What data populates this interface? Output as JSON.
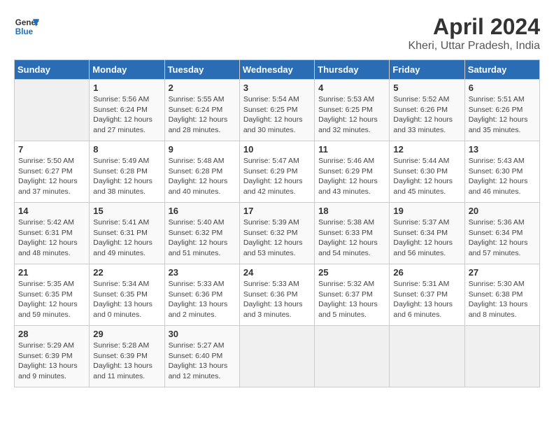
{
  "header": {
    "logo_line1": "General",
    "logo_line2": "Blue",
    "month": "April 2024",
    "location": "Kheri, Uttar Pradesh, India"
  },
  "weekdays": [
    "Sunday",
    "Monday",
    "Tuesday",
    "Wednesday",
    "Thursday",
    "Friday",
    "Saturday"
  ],
  "weeks": [
    [
      {
        "day": "",
        "info": ""
      },
      {
        "day": "1",
        "info": "Sunrise: 5:56 AM\nSunset: 6:24 PM\nDaylight: 12 hours\nand 27 minutes."
      },
      {
        "day": "2",
        "info": "Sunrise: 5:55 AM\nSunset: 6:24 PM\nDaylight: 12 hours\nand 28 minutes."
      },
      {
        "day": "3",
        "info": "Sunrise: 5:54 AM\nSunset: 6:25 PM\nDaylight: 12 hours\nand 30 minutes."
      },
      {
        "day": "4",
        "info": "Sunrise: 5:53 AM\nSunset: 6:25 PM\nDaylight: 12 hours\nand 32 minutes."
      },
      {
        "day": "5",
        "info": "Sunrise: 5:52 AM\nSunset: 6:26 PM\nDaylight: 12 hours\nand 33 minutes."
      },
      {
        "day": "6",
        "info": "Sunrise: 5:51 AM\nSunset: 6:26 PM\nDaylight: 12 hours\nand 35 minutes."
      }
    ],
    [
      {
        "day": "7",
        "info": "Sunrise: 5:50 AM\nSunset: 6:27 PM\nDaylight: 12 hours\nand 37 minutes."
      },
      {
        "day": "8",
        "info": "Sunrise: 5:49 AM\nSunset: 6:28 PM\nDaylight: 12 hours\nand 38 minutes."
      },
      {
        "day": "9",
        "info": "Sunrise: 5:48 AM\nSunset: 6:28 PM\nDaylight: 12 hours\nand 40 minutes."
      },
      {
        "day": "10",
        "info": "Sunrise: 5:47 AM\nSunset: 6:29 PM\nDaylight: 12 hours\nand 42 minutes."
      },
      {
        "day": "11",
        "info": "Sunrise: 5:46 AM\nSunset: 6:29 PM\nDaylight: 12 hours\nand 43 minutes."
      },
      {
        "day": "12",
        "info": "Sunrise: 5:44 AM\nSunset: 6:30 PM\nDaylight: 12 hours\nand 45 minutes."
      },
      {
        "day": "13",
        "info": "Sunrise: 5:43 AM\nSunset: 6:30 PM\nDaylight: 12 hours\nand 46 minutes."
      }
    ],
    [
      {
        "day": "14",
        "info": "Sunrise: 5:42 AM\nSunset: 6:31 PM\nDaylight: 12 hours\nand 48 minutes."
      },
      {
        "day": "15",
        "info": "Sunrise: 5:41 AM\nSunset: 6:31 PM\nDaylight: 12 hours\nand 49 minutes."
      },
      {
        "day": "16",
        "info": "Sunrise: 5:40 AM\nSunset: 6:32 PM\nDaylight: 12 hours\nand 51 minutes."
      },
      {
        "day": "17",
        "info": "Sunrise: 5:39 AM\nSunset: 6:32 PM\nDaylight: 12 hours\nand 53 minutes."
      },
      {
        "day": "18",
        "info": "Sunrise: 5:38 AM\nSunset: 6:33 PM\nDaylight: 12 hours\nand 54 minutes."
      },
      {
        "day": "19",
        "info": "Sunrise: 5:37 AM\nSunset: 6:34 PM\nDaylight: 12 hours\nand 56 minutes."
      },
      {
        "day": "20",
        "info": "Sunrise: 5:36 AM\nSunset: 6:34 PM\nDaylight: 12 hours\nand 57 minutes."
      }
    ],
    [
      {
        "day": "21",
        "info": "Sunrise: 5:35 AM\nSunset: 6:35 PM\nDaylight: 12 hours\nand 59 minutes."
      },
      {
        "day": "22",
        "info": "Sunrise: 5:34 AM\nSunset: 6:35 PM\nDaylight: 13 hours\nand 0 minutes."
      },
      {
        "day": "23",
        "info": "Sunrise: 5:33 AM\nSunset: 6:36 PM\nDaylight: 13 hours\nand 2 minutes."
      },
      {
        "day": "24",
        "info": "Sunrise: 5:33 AM\nSunset: 6:36 PM\nDaylight: 13 hours\nand 3 minutes."
      },
      {
        "day": "25",
        "info": "Sunrise: 5:32 AM\nSunset: 6:37 PM\nDaylight: 13 hours\nand 5 minutes."
      },
      {
        "day": "26",
        "info": "Sunrise: 5:31 AM\nSunset: 6:37 PM\nDaylight: 13 hours\nand 6 minutes."
      },
      {
        "day": "27",
        "info": "Sunrise: 5:30 AM\nSunset: 6:38 PM\nDaylight: 13 hours\nand 8 minutes."
      }
    ],
    [
      {
        "day": "28",
        "info": "Sunrise: 5:29 AM\nSunset: 6:39 PM\nDaylight: 13 hours\nand 9 minutes."
      },
      {
        "day": "29",
        "info": "Sunrise: 5:28 AM\nSunset: 6:39 PM\nDaylight: 13 hours\nand 11 minutes."
      },
      {
        "day": "30",
        "info": "Sunrise: 5:27 AM\nSunset: 6:40 PM\nDaylight: 13 hours\nand 12 minutes."
      },
      {
        "day": "",
        "info": ""
      },
      {
        "day": "",
        "info": ""
      },
      {
        "day": "",
        "info": ""
      },
      {
        "day": "",
        "info": ""
      }
    ]
  ]
}
